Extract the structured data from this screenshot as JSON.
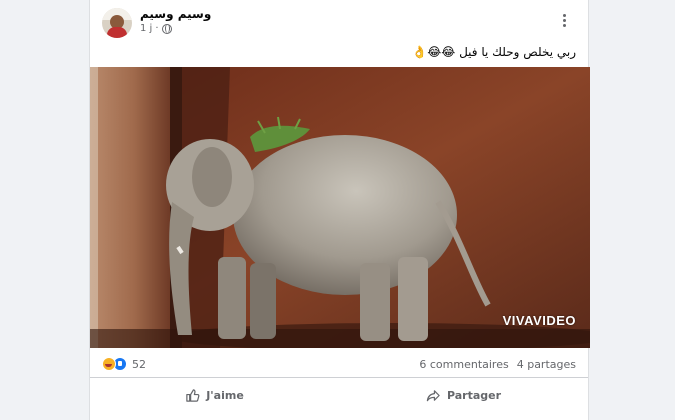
{
  "post": {
    "author_name": "وسيم وسيم",
    "timestamp": "1 j",
    "separator": "·",
    "privacy_icon": "globe-icon",
    "text": "ربي يخلص وحلك يا فيل 😂😂👌",
    "photo_watermark": "VIVAVIDEO",
    "reactions": {
      "icons": [
        "haha-reaction-icon",
        "like-reaction-icon"
      ],
      "count": "52"
    },
    "comments_label": "6 commentaires",
    "shares_label": "4 partages"
  },
  "actions": {
    "like_label": "J'aime",
    "share_label": "Partager"
  },
  "colors": {
    "page_bg": "#f0f2f5",
    "card_bg": "#ffffff",
    "secondary_text": "#65676b",
    "like_blue": "#1877f2",
    "haha_yellow": "#f7b125"
  }
}
